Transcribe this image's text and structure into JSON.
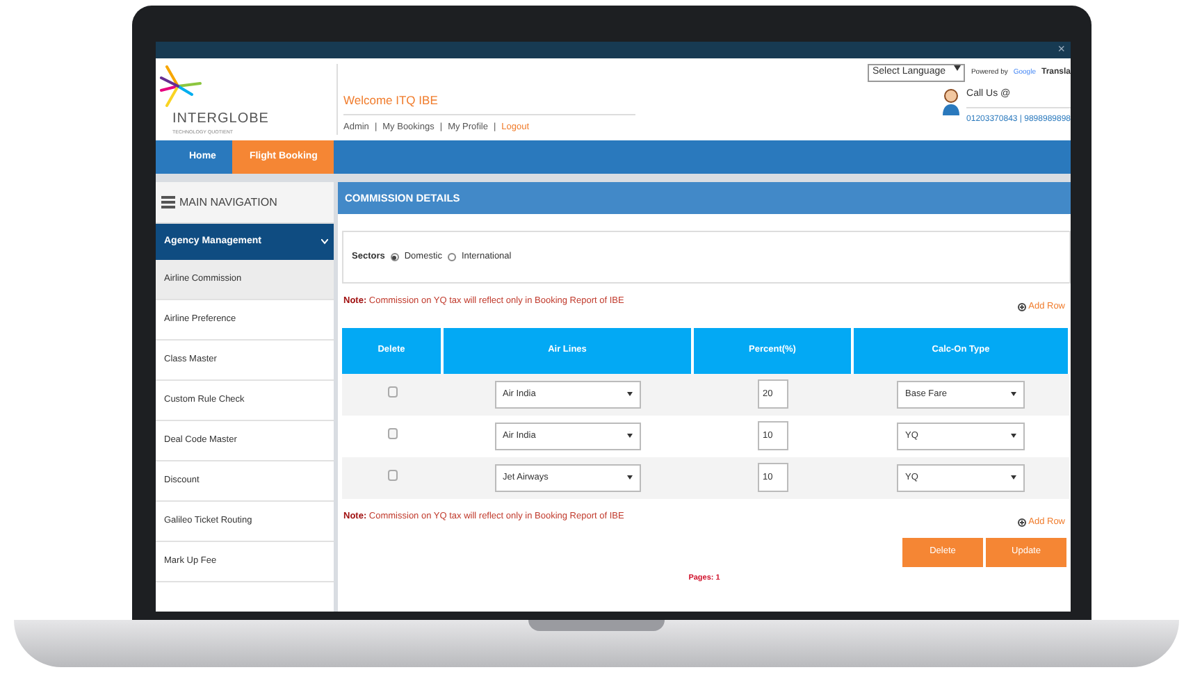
{
  "window": {
    "close_glyph": "×"
  },
  "header": {
    "logo": {
      "name": "INTERGLOBE",
      "tagline": "TECHNOLOGY QUOTIENT"
    },
    "welcome": "Welcome ITQ IBE",
    "links": [
      {
        "label": "Admin",
        "kind": "link"
      },
      {
        "separator": "|",
        "label": "My Bookings",
        "kind": "link"
      },
      {
        "separator": "|",
        "label": "My Profile",
        "kind": "link"
      },
      {
        "separator": "|",
        "label": "Logout",
        "kind": "logout"
      }
    ],
    "language_select": "Select Language",
    "powered_by": "Powered by",
    "google": "Google",
    "translate": "Transla",
    "call_us": "Call Us @",
    "phone": "01203370843 | 9898989898"
  },
  "nav_tabs": [
    {
      "label": "Home",
      "selected": false
    },
    {
      "label": "Flight Booking",
      "selected": true
    }
  ],
  "sidebar": {
    "title": "MAIN NAVIGATION",
    "group": {
      "label": "Agency Management",
      "expanded": true,
      "children": [
        {
          "label": "Airline Commission",
          "selected": true
        },
        {
          "label": "Airline Preference",
          "selected": false
        },
        {
          "label": "Class Master",
          "selected": false
        },
        {
          "label": "Custom Rule Check",
          "selected": false
        },
        {
          "label": "Deal Code Master",
          "selected": false
        },
        {
          "label": "Discount",
          "selected": false
        },
        {
          "label": "Galileo Ticket Routing",
          "selected": false
        },
        {
          "label": "Mark Up Fee",
          "selected": false
        }
      ]
    }
  },
  "panel": {
    "title": "COMMISSION DETAILS",
    "sectors_label": "Sectors",
    "sectors": [
      {
        "label": "Domestic",
        "selected": true
      },
      {
        "label": "International",
        "selected": false
      }
    ],
    "note_top": "**Note:** Commission on YQ tax will reflect only in Booking Report of IBE",
    "add_row_top": "Add Row",
    "columns": [
      "Delete",
      "Air Lines",
      "Percent(%)",
      "Calc-On Type"
    ],
    "rows": [
      {
        "checked": false,
        "airline": "Air India",
        "percent": "20",
        "calc_on": "Base Fare"
      },
      {
        "checked": false,
        "airline": "Air India",
        "percent": "10",
        "calc_on": "YQ"
      },
      {
        "checked": false,
        "airline": "Jet Airways",
        "percent": "10",
        "calc_on": "YQ"
      }
    ],
    "note_bottom": "**Note:** Commission on YQ tax will reflect only in Booking Report of IBE",
    "add_row_bottom": "Add Row",
    "buttons": [
      "Delete",
      "Update"
    ],
    "pages": "Pages: 1"
  }
}
